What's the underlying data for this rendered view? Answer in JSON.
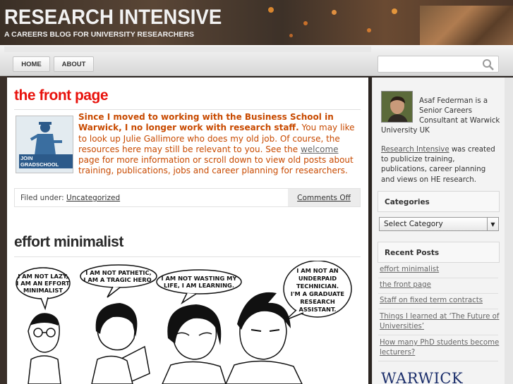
{
  "site": {
    "title": "RESEARCH INTENSIVE",
    "description": "A CAREERS BLOG FOR UNIVERSITY RESEARCHERS"
  },
  "nav": {
    "items": [
      {
        "label": "HOME"
      },
      {
        "label": "ABOUT"
      }
    ],
    "search_placeholder": ""
  },
  "posts": [
    {
      "title": "the front page",
      "title_color": "#e8120c",
      "thumb_label": "JOIN GRADSCHOOL",
      "lead_bold": "Since I moved to working with the Business School in Warwick, I no longer work with research staff.",
      "body_1": " You may like to look up Julie Gallimore who does my old job. Of course, the resources here may still be relevant to you. See the ",
      "link": "welcome",
      "body_2": " page for more information or scroll down to view old posts about training, publications, jobs and career planning for researchers.",
      "filed_under_label": "Filed under:",
      "category": "Uncategorized",
      "comments": "Comments Off"
    },
    {
      "title": "effort minimalist",
      "title_color": "#2a2a2a",
      "comic": {
        "bubble_1": [
          "I AM NOT LAZY,",
          "I AM AN EFFORT",
          "MINIMALIST"
        ],
        "bubble_2": [
          "I AM NOT PATHETIC,",
          "I AM A TRAGIC HERO."
        ],
        "bubble_3": [
          "I AM NOT WASTING MY",
          "LIFE, I AM LEARNING."
        ],
        "bubble_4": [
          "I AM NOT AN",
          "UNDERPAID",
          "TECHNICIAN.",
          "I'M A GRADUATE",
          "RESEARCH",
          "ASSISTANT."
        ]
      }
    }
  ],
  "sidebar": {
    "bio_lines": [
      "Asaf Federman is a",
      "Senior Careers",
      "Consultant at Warwick"
    ],
    "bio_last": "University UK",
    "desc_link": "Research Intensive",
    "desc_text": " was created to publicize training, publications, career planning and views on HE research.",
    "categories_heading": "Categories",
    "select_value": "Select Category",
    "recent_heading": "Recent Posts",
    "recent_posts": [
      "effort minimalist",
      "the front page",
      "Staff on fixed term contracts",
      "Things I learned at ‘The Future of Universities’",
      "How many PhD students become lecturers?"
    ],
    "logo": "WARWICK"
  }
}
